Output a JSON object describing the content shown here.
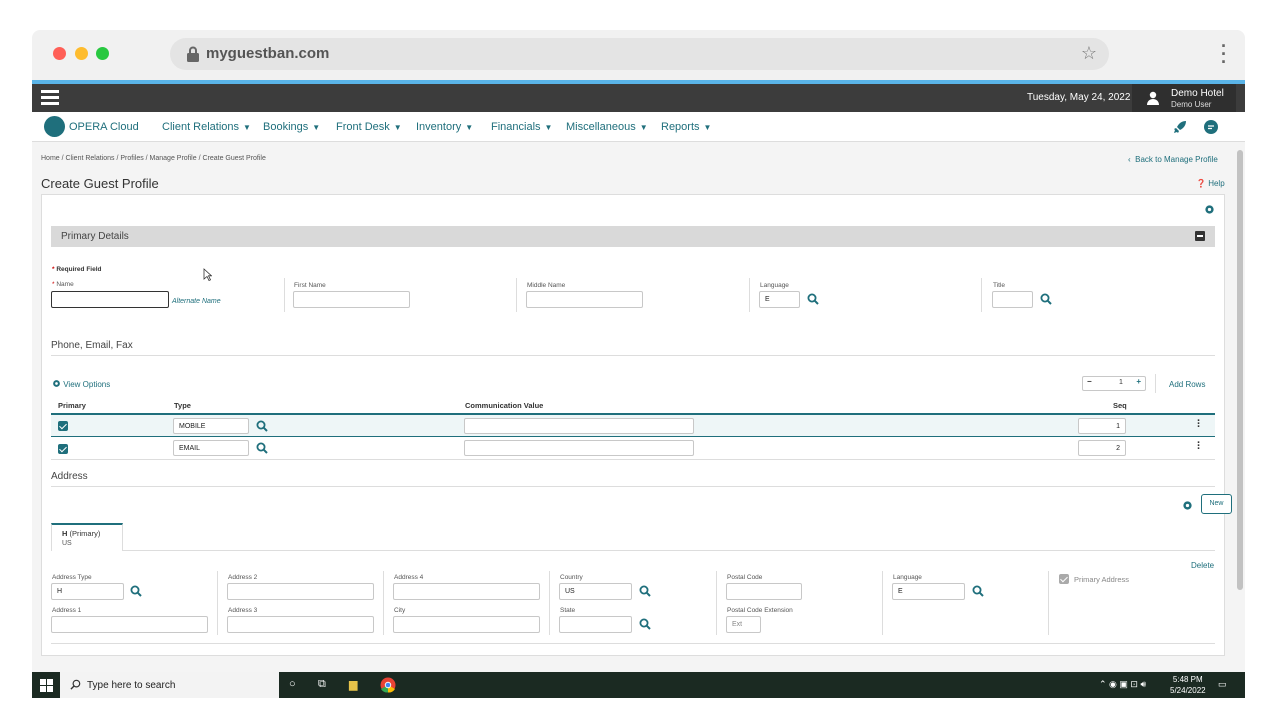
{
  "browser": {
    "url": "myguestban.com"
  },
  "header": {
    "date": "Tuesday, May 24, 2022",
    "hotel": "Demo Hotel",
    "user": "Demo User"
  },
  "nav": {
    "logo": "OPERA Cloud",
    "items": [
      "Client Relations",
      "Bookings",
      "Front Desk",
      "Inventory",
      "Financials",
      "Miscellaneous",
      "Reports"
    ]
  },
  "breadcrumb": "Home / Client Relations / Profiles / Manage Profile / Create Guest Profile",
  "back_link": "Back to Manage Profile",
  "page_title": "Create Guest Profile",
  "help": "Help",
  "primary": {
    "section_title": "Primary Details",
    "required_note": "Required Field",
    "name_label": "Name",
    "alternate_name": "Alternate Name",
    "first_name_label": "First Name",
    "middle_name_label": "Middle Name",
    "language_label": "Language",
    "language_value": "E",
    "title_label": "Title"
  },
  "comm": {
    "section_title": "Phone, Email, Fax",
    "view_options": "View Options",
    "rows_count": "1",
    "add_rows": "Add Rows",
    "headers": {
      "primary": "Primary",
      "type": "Type",
      "value": "Communication Value",
      "seq": "Seq"
    },
    "rows": [
      {
        "type": "MOBILE",
        "value": "",
        "seq": "1"
      },
      {
        "type": "EMAIL",
        "value": "",
        "seq": "2"
      }
    ]
  },
  "address": {
    "section_title": "Address",
    "new_button": "New",
    "tab_type": "H",
    "tab_primary": "(Primary)",
    "tab_country": "US",
    "delete": "Delete",
    "address_type_label": "Address Type",
    "address_type_value": "H",
    "address1_label": "Address 1",
    "address2_label": "Address 2",
    "address3_label": "Address 3",
    "address4_label": "Address 4",
    "city_label": "City",
    "country_label": "Country",
    "country_value": "US",
    "state_label": "State",
    "postal_label": "Postal Code",
    "postal_ext_label": "Postal Code Extension",
    "postal_ext_placeholder": "Ext",
    "language_label": "Language",
    "language_value": "E",
    "primary_address": "Primary Address"
  },
  "taskbar": {
    "search": "Type here to search",
    "time": "5:48 PM",
    "date": "5/24/2022"
  }
}
